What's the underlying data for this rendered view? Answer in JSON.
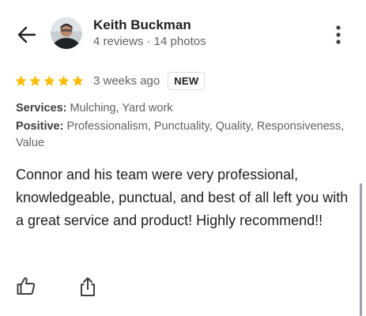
{
  "reviewer": {
    "name": "Keith Buckman",
    "meta": "4 reviews · 14 photos"
  },
  "review": {
    "rating": 5,
    "max_rating": 5,
    "time": "3 weeks ago",
    "badge": "NEW",
    "services_label": "Services:",
    "services_value": "Mulching, Yard work",
    "positive_label": "Positive:",
    "positive_value": "Professionalism, Punctuality, Quality, Responsiveness, Value",
    "text": "Connor and his team were very professional, knowledgeable, punctual, and best of all left you with a great service and product! Highly recommend!!"
  },
  "colors": {
    "star": "#fbbc04",
    "text_primary": "#202124",
    "text_secondary": "#5f6368"
  },
  "icons": {
    "back": "arrow-back-icon",
    "more": "more-vert-icon",
    "like": "thumb-up-icon",
    "share": "share-icon"
  }
}
